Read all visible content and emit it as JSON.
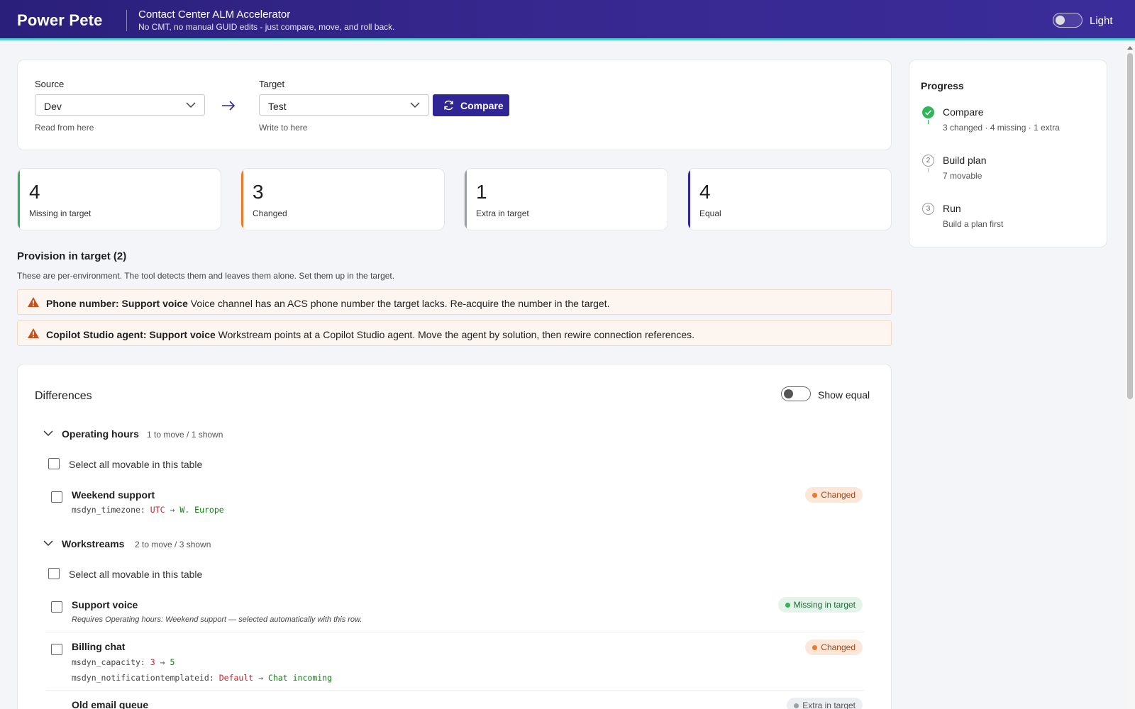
{
  "header": {
    "brand": "Power Pete",
    "title": "Contact Center ALM Accelerator",
    "subtitle": "No CMT, no manual GUID edits - just compare, move, and roll back.",
    "theme_label": "Light"
  },
  "env_picker": {
    "source": {
      "label": "Source",
      "value": "Dev",
      "hint": "Read from here"
    },
    "target": {
      "label": "Target",
      "value": "Test",
      "hint": "Write to here"
    },
    "compare_label": "Compare"
  },
  "stats": [
    {
      "value": "4",
      "label": "Missing in target",
      "color": "#2fb55a"
    },
    {
      "value": "3",
      "label": "Changed",
      "color": "#ea7a2c"
    },
    {
      "value": "1",
      "label": "Extra in target",
      "color": "#9aa0a8"
    },
    {
      "value": "4",
      "label": "Equal",
      "color": "#2f2594"
    }
  ],
  "provision": {
    "title": "Provision in target (2)",
    "description": "These are per-environment. The tool detects them and leaves them alone. Set them up in the target.",
    "warnings": [
      {
        "title": "Phone number: Support voice",
        "text": " Voice channel has an ACS phone number the target lacks. Re-acquire the number in the target."
      },
      {
        "title": "Copilot Studio agent: Support voice",
        "text": " Workstream points at a Copilot Studio agent. Move the agent by solution, then rewire connection references."
      }
    ]
  },
  "differences": {
    "title": "Differences",
    "show_equal_label": "Show equal",
    "select_all_label": "Select all movable in this table",
    "groups": [
      {
        "name": "Operating hours",
        "count": "1 to move / 1 shown",
        "rows": [
          {
            "name": "Weekend support",
            "badge": "Changed",
            "fields": [
              {
                "label": "msdyn_timezone:",
                "old": "UTC",
                "arrow": "→",
                "new": "W. Europe"
              }
            ]
          }
        ]
      },
      {
        "name": "Workstreams",
        "count": "2 to move / 3 shown",
        "rows": [
          {
            "name": "Support voice",
            "badge": "Missing in target",
            "note": "Requires Operating hours: Weekend support — selected automatically with this row."
          },
          {
            "name": "Billing chat",
            "badge": "Changed",
            "fields": [
              {
                "label": "msdyn_capacity:",
                "old": "3",
                "arrow": "→",
                "new": "5"
              },
              {
                "label": "msdyn_notificationtemplateid:",
                "old": "Default",
                "arrow": "→",
                "new": "Chat incoming"
              }
            ]
          },
          {
            "name": "Old email queue",
            "badge": "Extra in target"
          }
        ]
      }
    ]
  },
  "progress": {
    "title": "Progress",
    "steps": [
      {
        "marker": "",
        "name": "Compare",
        "sub": "3 changed · 4 missing · 1 extra",
        "status": "done"
      },
      {
        "marker": "2",
        "name": "Build plan",
        "sub": "7 movable",
        "status": "pending"
      },
      {
        "marker": "3",
        "name": "Run",
        "sub": "Build a plan first",
        "status": "pending"
      }
    ]
  },
  "icons": {
    "compare": "refresh-icon",
    "warning": "warning-triangle-icon",
    "arrow": "arrow-right-icon",
    "chevron": "chevron-down-icon",
    "check": "check-circle-icon"
  },
  "colors": {
    "brand": "#2f2594",
    "accent_line": "#4fd1c5",
    "warning": "#c8501a"
  }
}
